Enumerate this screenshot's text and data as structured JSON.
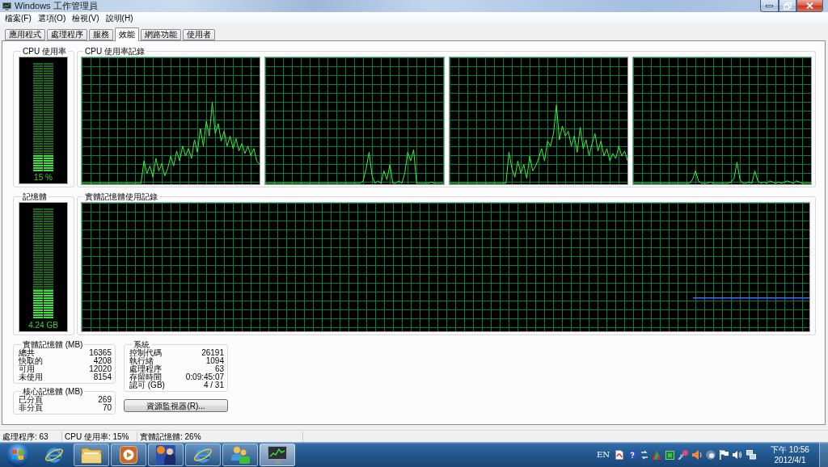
{
  "window": {
    "title": "Windows 工作管理員"
  },
  "menu": [
    "檔案(F)",
    "選項(O)",
    "檢視(V)",
    "說明(H)"
  ],
  "tabs": [
    {
      "label": "應用程式",
      "selected": false
    },
    {
      "label": "處理程序",
      "selected": false
    },
    {
      "label": "服務",
      "selected": false
    },
    {
      "label": "效能",
      "selected": true
    },
    {
      "label": "網路功能",
      "selected": false
    },
    {
      "label": "使用者",
      "selected": false
    }
  ],
  "cpu_usage": {
    "title": "CPU 使用率",
    "level": 0.15,
    "reading": "15 %"
  },
  "cpu_history": {
    "title": "CPU 使用率記錄"
  },
  "memory": {
    "title": "記憶體",
    "level": 0.26,
    "reading": "4.24 GB"
  },
  "memory_history": {
    "title": "實體記憶體使用記錄"
  },
  "physical_memory": {
    "title": "實體記憶體 (MB)",
    "rows": [
      {
        "label": "總共",
        "value": "16365"
      },
      {
        "label": "快取的",
        "value": "4208"
      },
      {
        "label": "可用",
        "value": "12020"
      },
      {
        "label": "未使用",
        "value": "8154"
      }
    ]
  },
  "kernel_memory": {
    "title": "核心記憶體 (MB)",
    "rows": [
      {
        "label": "已分頁",
        "value": "269"
      },
      {
        "label": "非分頁",
        "value": "70"
      }
    ]
  },
  "system": {
    "title": "系統",
    "rows": [
      {
        "label": "控制代碼",
        "value": "26191"
      },
      {
        "label": "執行緒",
        "value": "1094"
      },
      {
        "label": "處理程序",
        "value": "63"
      },
      {
        "label": "存留時間",
        "value": "0:09:45:07"
      },
      {
        "label": "認可 (GB)",
        "value": "4 / 31"
      }
    ]
  },
  "resource_monitor_button": {
    "label": "資源監視器(R)..."
  },
  "status_bar": [
    "處理程序: 63",
    "CPU 使用率: 15%",
    "實體記憶體: 26%"
  ],
  "taskbar": {
    "apps": [
      {
        "kind": "browser",
        "running": false,
        "selected": false
      },
      {
        "kind": "folder",
        "running": true,
        "selected": false
      },
      {
        "kind": "media",
        "running": true,
        "selected": false
      },
      {
        "kind": "game",
        "running": true,
        "selected": false
      },
      {
        "kind": "browser",
        "running": true,
        "selected": false
      },
      {
        "kind": "messenger",
        "running": true,
        "selected": false
      },
      {
        "kind": "monitor",
        "running": true,
        "selected": true
      }
    ],
    "language": "EN",
    "time": "下午 10:56",
    "date": "2012/4/1"
  }
}
